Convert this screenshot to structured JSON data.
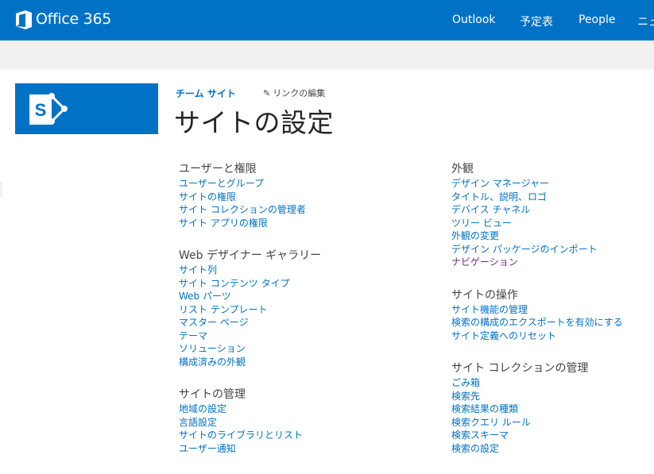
{
  "suite_bar": {
    "brand": "Office 365",
    "nav": [
      "Outlook",
      "予定表",
      "People",
      "ニュー"
    ]
  },
  "site": {
    "breadcrumb": "チーム サイト",
    "edit_links": "リンクの編集",
    "title": "サイトの設定"
  },
  "left_column": [
    {
      "title": "ユーザーと権限",
      "links": [
        "ユーザーとグループ",
        "サイトの権限",
        "サイト コレクションの管理者",
        "サイト アプリの権限"
      ]
    },
    {
      "title": "Web デザイナー ギャラリー",
      "links": [
        "サイト列",
        "サイト コンテンツ タイプ",
        "Web パーツ",
        "リスト テンプレート",
        "マスター ページ",
        "テーマ",
        "ソリューション",
        "構成済みの外観"
      ]
    },
    {
      "title": "サイトの管理",
      "links": [
        "地域の設定",
        "言語設定",
        "サイトのライブラリとリスト",
        "ユーザー通知"
      ]
    }
  ],
  "right_column": [
    {
      "title": "外観",
      "links": [
        "デザイン マネージャー",
        "タイトル、説明、ロゴ",
        "デバイス チャネル",
        "ツリー ビュー",
        "外観の変更",
        "デザイン パッケージのインポート",
        "ナビゲーション"
      ]
    },
    {
      "title": "サイトの操作",
      "links": [
        "サイト機能の管理",
        "検索の構成のエクスポートを有効にする",
        "サイト定義へのリセット"
      ]
    },
    {
      "title": "サイト コレクションの管理",
      "links": [
        "ごみ箱",
        "検索先",
        "検索結果の種類",
        "検索クエリ ルール",
        "検索スキーマ",
        "検索の設定"
      ]
    }
  ],
  "colors": {
    "suite_bar": "#0072c6",
    "link": "#0072c6",
    "visited_link": "#6f2b8a",
    "ribbon": "#f1f1f1"
  }
}
